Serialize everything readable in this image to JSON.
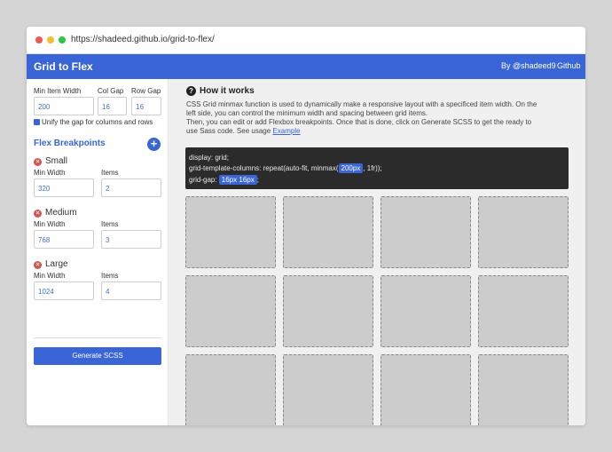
{
  "browser": {
    "url": "https://shadeed.github.io/grid-to-flex/"
  },
  "appbar": {
    "title": "Grid to Flex",
    "user_link": "By @shadeed9",
    "github_link": "Github"
  },
  "sidebar": {
    "min_item_width_label": "Min Item Width",
    "col_gap_label": "Col Gap",
    "row_gap_label": "Row Gap",
    "min_item_width": "200",
    "col_gap": "16",
    "row_gap": "16",
    "unify_label": "Unify the gap for columns and rows",
    "breakpoints_title": "Flex Breakpoints",
    "add_icon": "+",
    "remove_icon": "×",
    "breakpoints": [
      {
        "name": "Small",
        "min_width_label": "Min Width",
        "items_label": "Items",
        "min_width": "320",
        "items": "2"
      },
      {
        "name": "Medium",
        "min_width_label": "Min Width",
        "items_label": "Items",
        "min_width": "768",
        "items": "3"
      },
      {
        "name": "Large",
        "min_width_label": "Min Width",
        "items_label": "Items",
        "min_width": "1024",
        "items": "4"
      }
    ],
    "generate_label": "Generate SCSS"
  },
  "main": {
    "how_icon": "?",
    "how_title": "How it works",
    "desc_line1": "CSS Grid minmax function is used to dynamically make a responsive layout with a specificed item width. On the",
    "desc_line2": "left side, you can control the minimum width and spacing between grid items.",
    "desc_line3": "Then, you can edit or add Flexbox breakpoints. Once that is done, click on Generate SCSS to get the ready to",
    "desc_line4_prefix": "use Sass code. See usage",
    "example_link": "Example",
    "code": {
      "line1": "display: grid;",
      "line2_prefix": "grid-template-columns: repeat(auto-fit, minmax(",
      "line2_value": "200px",
      "line2_suffix": ", 1fr));",
      "line3_prefix": "grid-gap: ",
      "line3_value": "16px 16px",
      "line3_suffix": ";"
    }
  },
  "colors": {
    "accent": "#3a65d6",
    "danger": "#d9534f",
    "code_bg": "#2b2b2b",
    "cell_bg": "#cccccc"
  }
}
